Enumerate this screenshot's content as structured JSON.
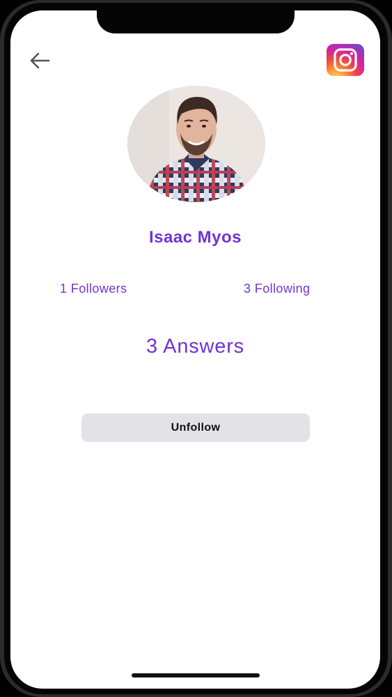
{
  "profile": {
    "name": "Isaac Myos",
    "followers_label": "1 Followers",
    "following_label": "3 Following",
    "answers_label": "3 Answers"
  },
  "actions": {
    "unfollow_label": "Unfollow"
  },
  "icons": {
    "back": "arrow-left-icon",
    "instagram": "instagram-icon"
  },
  "colors": {
    "accent": "#6f33d6",
    "button_bg": "#e3e2e6",
    "background": "#ffffff"
  }
}
